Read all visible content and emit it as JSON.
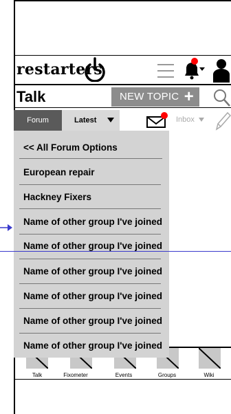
{
  "header": {
    "logo_text": "restarters"
  },
  "talk": {
    "title": "Talk",
    "new_topic_label": "NEW TOPIC"
  },
  "filter": {
    "forum_label": "Forum",
    "latest_label": "Latest",
    "inbox_label": "Inbox"
  },
  "dropdown": {
    "items": [
      "<< All Forum Options",
      "European repair",
      "Hackney Fixers",
      "Name of other group I've joined",
      "Name of other group I've joined",
      "Name of other group I've joined",
      "Name of other group I've joined",
      "Name of other group I've joined",
      "Name of other group I've joined"
    ]
  },
  "nav": {
    "items": [
      "Talk",
      "Fixometer",
      "Events",
      "Groups",
      "Wiki"
    ]
  },
  "colors": {
    "notification_dot": "#ff0000",
    "button_gray": "#8c8c8c",
    "forum_tab": "#5a5a5a",
    "dropdown_bg": "#d3d3d3",
    "annotation_blue": "#3a3acc"
  }
}
